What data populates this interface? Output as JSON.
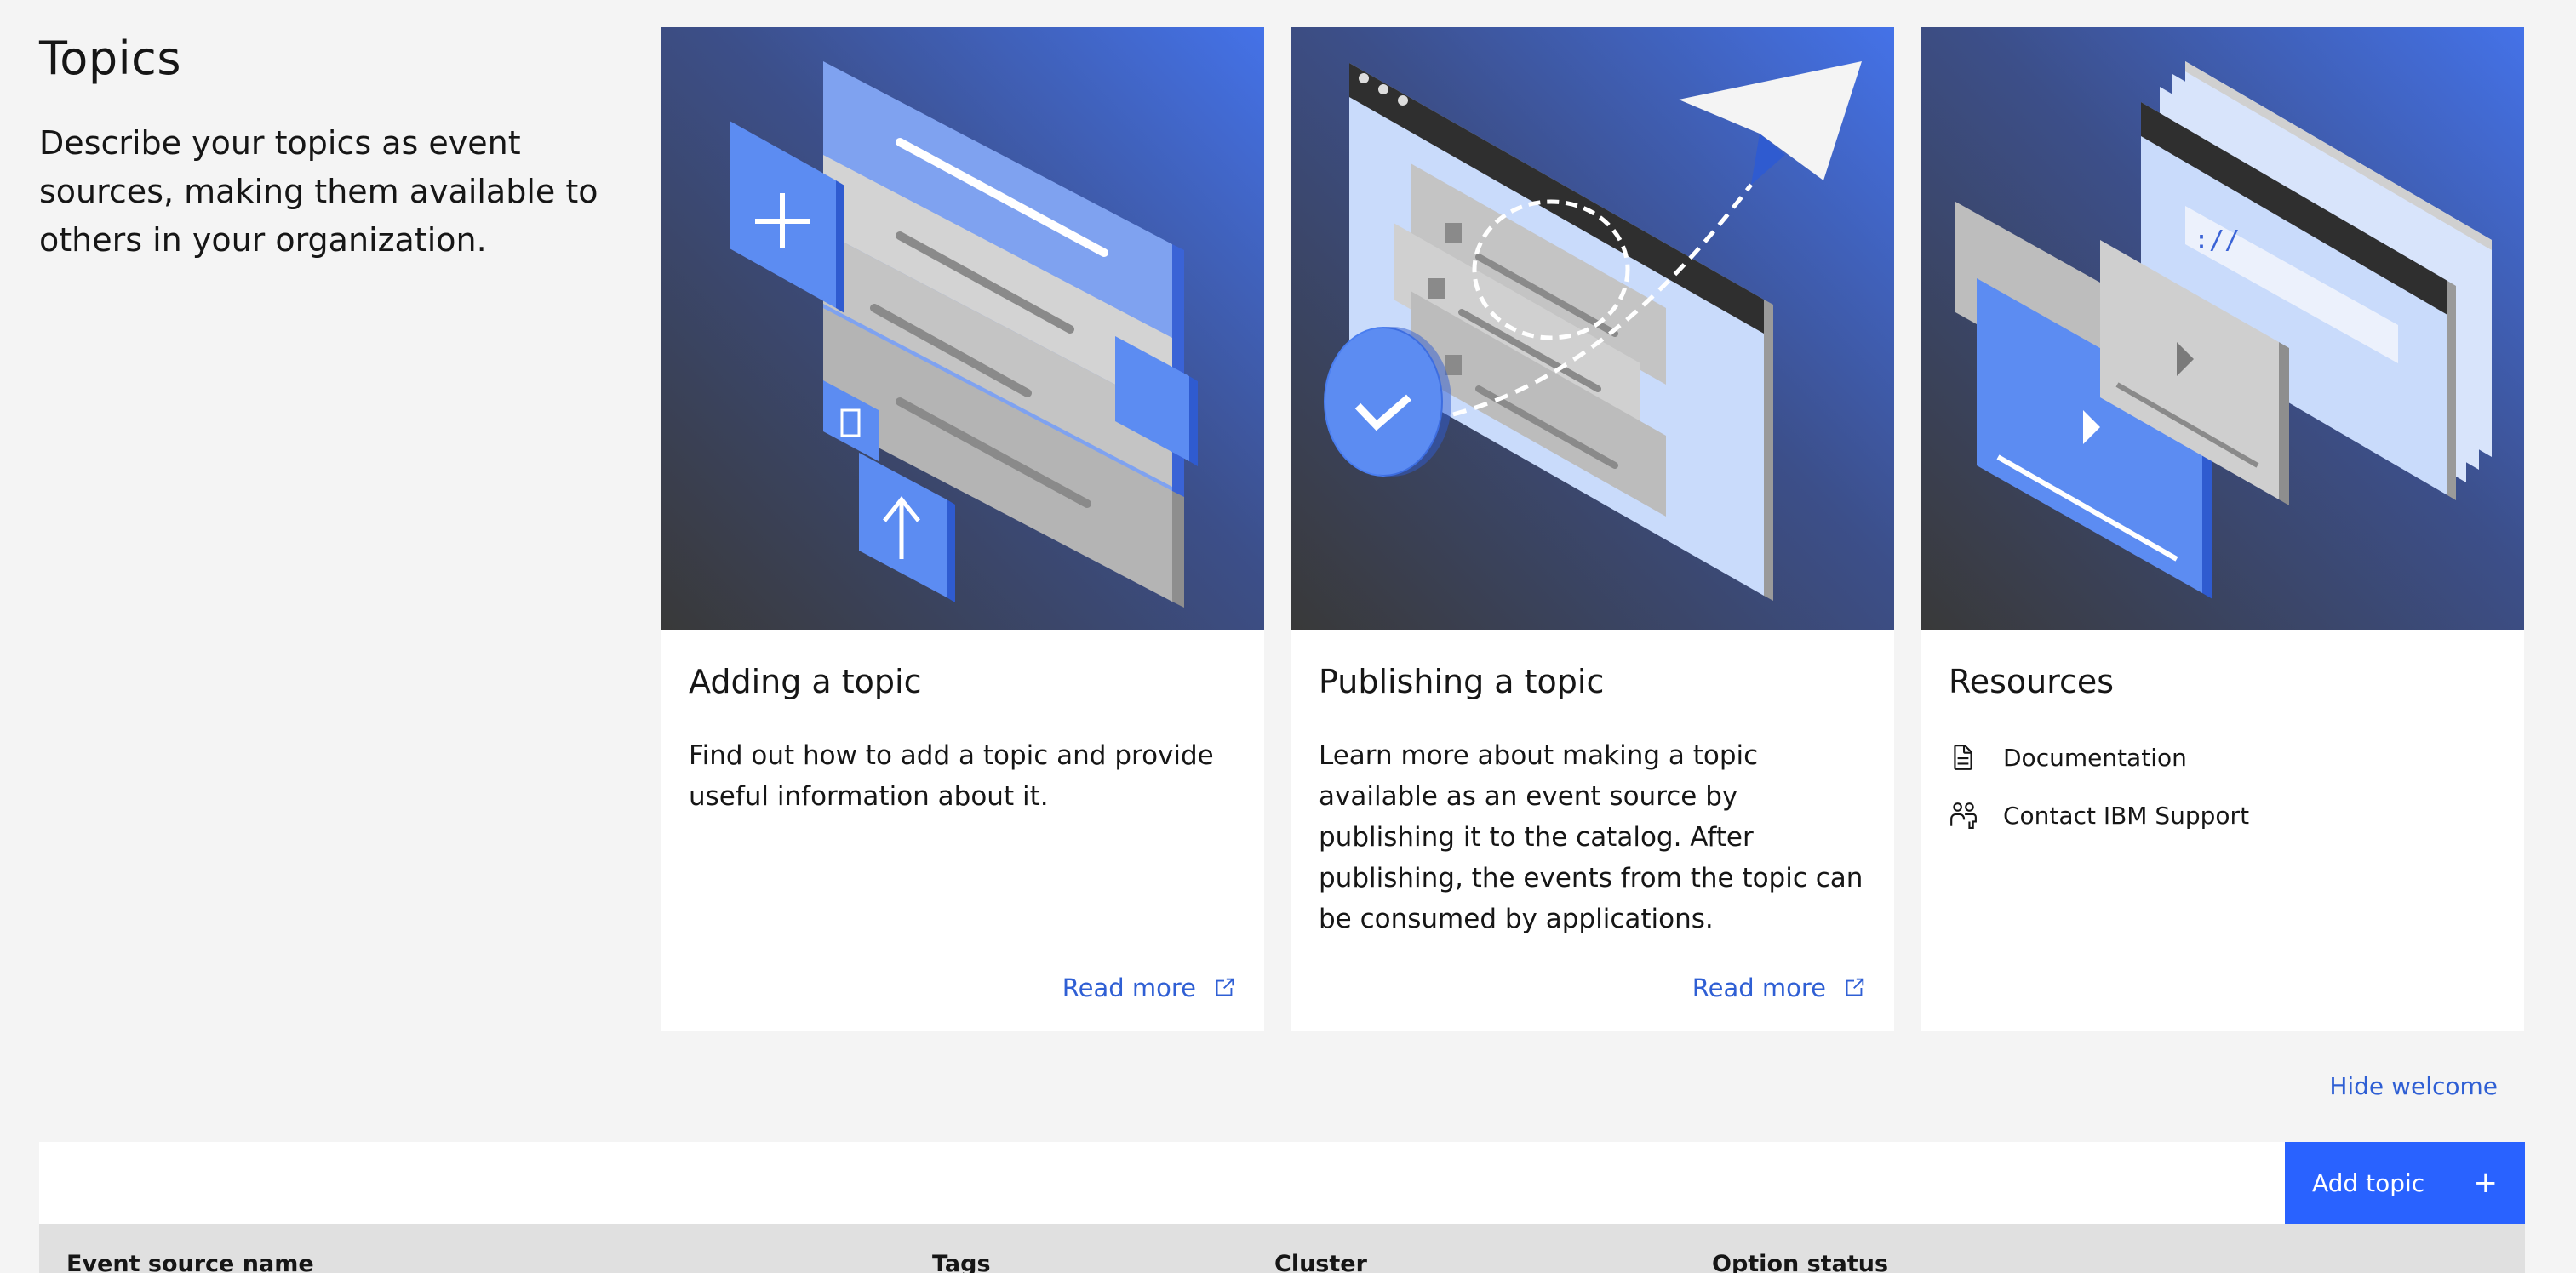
{
  "intro": {
    "title": "Topics",
    "description": "Describe your topics as event sources, making them available to others in your organization."
  },
  "cards": [
    {
      "title": "Adding a topic",
      "description": "Find out how to add a topic and provide useful information about it.",
      "link_label": "Read more",
      "link_icon": "launch-icon"
    },
    {
      "title": "Publishing a topic",
      "description": "Learn more about making a topic available as an event source by publishing it to the catalog. After publishing, the events from the topic can be consumed by applications.",
      "link_label": "Read more",
      "link_icon": "launch-icon"
    },
    {
      "title": "Resources",
      "items": [
        {
          "label": "Documentation",
          "icon": "document-icon"
        },
        {
          "label": "Contact IBM Support",
          "icon": "support-icon"
        }
      ]
    }
  ],
  "hide_welcome": "Hide welcome",
  "toolbar": {
    "add_label": "Add topic",
    "add_icon": "plus-icon"
  },
  "table": {
    "columns": [
      "Event source name",
      "Tags",
      "Cluster",
      "Option status"
    ]
  },
  "colors": {
    "accent": "#2962ff",
    "link": "#2f5fd4",
    "background": "#f4f4f4",
    "header": "#e0e0e0"
  }
}
